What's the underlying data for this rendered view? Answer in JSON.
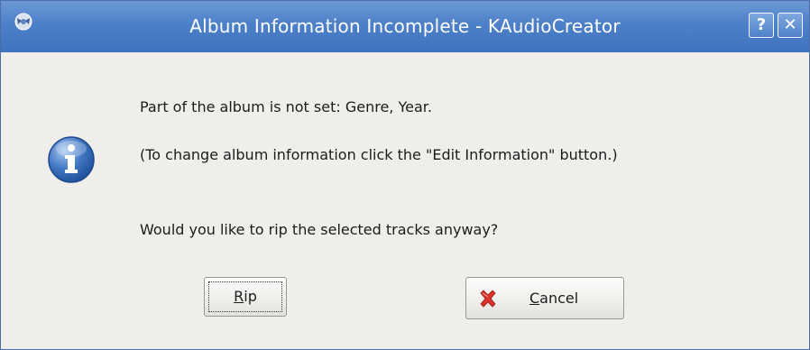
{
  "window": {
    "title": "Album Information Incomplete - KAudioCreator",
    "help_label": "?",
    "close_label": "✕"
  },
  "colors": {
    "titlebar": "#4d80c9",
    "background": "#efeeeb",
    "info_icon": "#2f66b4",
    "cancel_icon": "#d8322a"
  },
  "icons": {
    "app": "kaudiocreator-app-icon",
    "info": "information-icon",
    "cancel": "cancel-x-icon"
  },
  "message": {
    "line1": "Part of the album is not set: Genre, Year.",
    "line2": "(To change album information click the \"Edit Information\" button.)",
    "line3": "Would you like to rip the selected tracks anyway?"
  },
  "buttons": {
    "rip": {
      "mnemonic": "R",
      "rest": "ip"
    },
    "cancel": {
      "mnemonic": "C",
      "rest": "ancel"
    }
  }
}
